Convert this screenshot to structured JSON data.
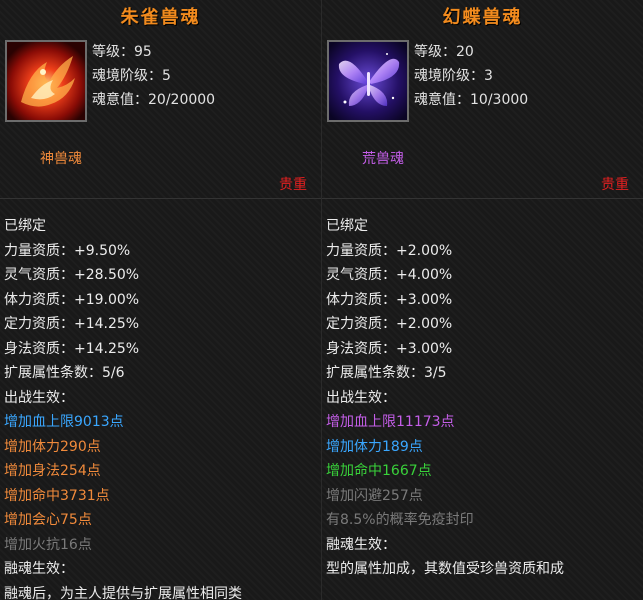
{
  "left": {
    "title": "朱雀兽魂",
    "icon": "phoenix-icon",
    "level": "等级：95",
    "realm": "魂境阶级：5",
    "soul_value": "魂意值：20/20000",
    "type": "神兽魂",
    "quality": "贵重",
    "bound": "已绑定",
    "aptitudes": [
      "力量资质：+9.50%",
      "灵气资质：+28.50%",
      "体力资质：+19.00%",
      "定力资质：+14.25%",
      "身法资质：+14.25%"
    ],
    "ext_count": "扩展属性条数：5/6",
    "battle_header": "出战生效：",
    "effects": [
      "增加血上限9013点",
      "增加体力290点",
      "增加身法254点",
      "增加命中3731点",
      "增加会心75点",
      "增加火抗16点"
    ],
    "fusion_header": "融魂生效：",
    "fusion_text": "融魂后，为主人提供与扩展属性相同类"
  },
  "right": {
    "title": "幻蝶兽魂",
    "icon": "butterfly-icon",
    "level": "等级：20",
    "realm": "魂境阶级：3",
    "soul_value": "魂意值：10/3000",
    "type": "荒兽魂",
    "quality": "贵重",
    "bound": "已绑定",
    "aptitudes": [
      "力量资质：+2.00%",
      "灵气资质：+4.00%",
      "体力资质：+3.00%",
      "定力资质：+2.00%",
      "身法资质：+3.00%"
    ],
    "ext_count": "扩展属性条数：3/5",
    "battle_header": "出战生效：",
    "effects": [
      "增加血上限11173点",
      "增加体力189点",
      "增加命中1667点",
      "增加闪避257点",
      "有8.5%的概率免疫封印"
    ],
    "fusion_header": "融魂生效：",
    "fusion_text": "型的属性加成，其数值受珍兽资质和成"
  }
}
